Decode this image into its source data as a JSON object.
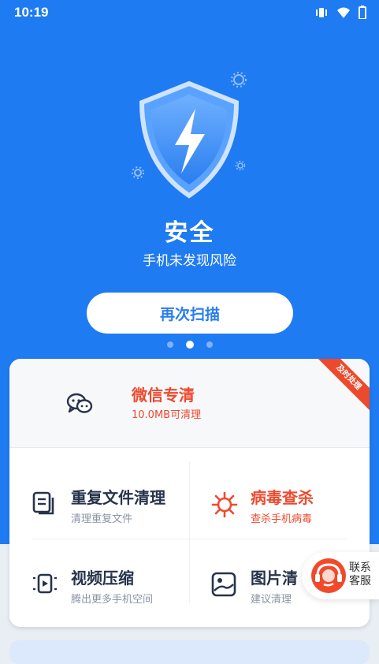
{
  "status_bar": {
    "time": "10:19",
    "icons": [
      "vibrate-icon",
      "wifi-icon",
      "battery-icon"
    ]
  },
  "hero": {
    "title": "安全",
    "subtitle": "手机未发现风险",
    "rescan_button": "再次扫描",
    "page_indicator": {
      "count": 3,
      "active_index": 1
    }
  },
  "wechat_card": {
    "title": "微信专清",
    "subtitle": "10.0MB可清理",
    "ribbon": "及时处理"
  },
  "features": [
    {
      "title": "重复文件清理",
      "subtitle": "清理重复文件",
      "icon": "duplicate-files-icon",
      "highlight": false
    },
    {
      "title": "病毒查杀",
      "subtitle": "查杀手机病毒",
      "icon": "virus-icon",
      "highlight": true
    },
    {
      "title": "视频压缩",
      "subtitle": "腾出更多手机空间",
      "icon": "video-compress-icon",
      "highlight": false
    },
    {
      "title": "图片清",
      "subtitle": "建议清理",
      "icon": "image-clean-icon",
      "highlight": false
    }
  ],
  "contact": {
    "line1": "联系",
    "line2": "客服"
  },
  "colors": {
    "primary": "#1f7bf2",
    "accent_red": "#ee4a2f",
    "text_dark": "#27334a"
  }
}
